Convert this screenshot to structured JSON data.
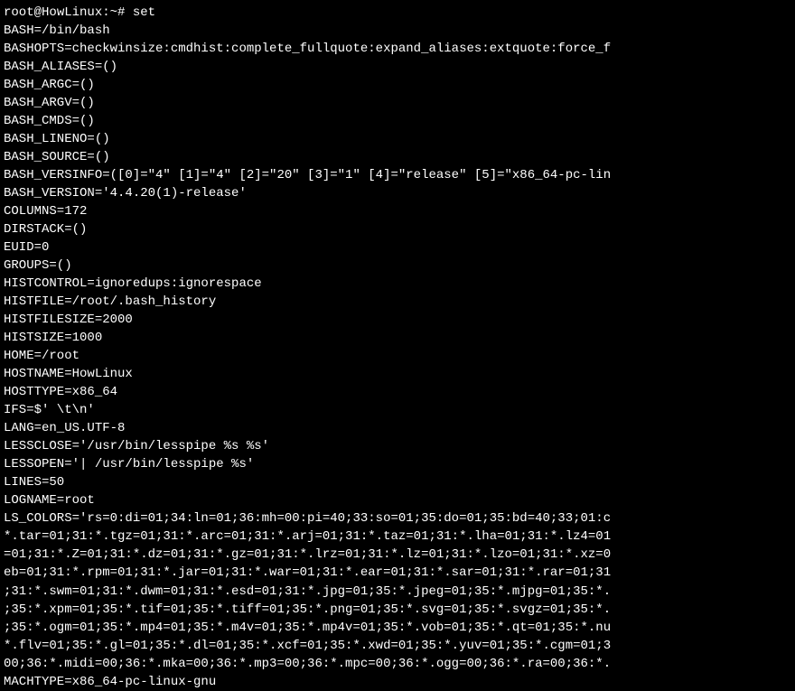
{
  "prompt": {
    "user": "root",
    "host": "HowLinux",
    "path": "~",
    "symbol": "#",
    "command": "set"
  },
  "output": [
    "BASH=/bin/bash",
    "BASHOPTS=checkwinsize:cmdhist:complete_fullquote:expand_aliases:extquote:force_f",
    "BASH_ALIASES=()",
    "BASH_ARGC=()",
    "BASH_ARGV=()",
    "BASH_CMDS=()",
    "BASH_LINENO=()",
    "BASH_SOURCE=()",
    "BASH_VERSINFO=([0]=\"4\" [1]=\"4\" [2]=\"20\" [3]=\"1\" [4]=\"release\" [5]=\"x86_64-pc-lin",
    "BASH_VERSION='4.4.20(1)-release'",
    "COLUMNS=172",
    "DIRSTACK=()",
    "EUID=0",
    "GROUPS=()",
    "HISTCONTROL=ignoredups:ignorespace",
    "HISTFILE=/root/.bash_history",
    "HISTFILESIZE=2000",
    "HISTSIZE=1000",
    "HOME=/root",
    "HOSTNAME=HowLinux",
    "HOSTTYPE=x86_64",
    "IFS=$' \\t\\n'",
    "LANG=en_US.UTF-8",
    "LESSCLOSE='/usr/bin/lesspipe %s %s'",
    "LESSOPEN='| /usr/bin/lesspipe %s'",
    "LINES=50",
    "LOGNAME=root",
    "LS_COLORS='rs=0:di=01;34:ln=01;36:mh=00:pi=40;33:so=01;35:do=01;35:bd=40;33;01:c",
    "*.tar=01;31:*.tgz=01;31:*.arc=01;31:*.arj=01;31:*.taz=01;31:*.lha=01;31:*.lz4=01",
    "=01;31:*.Z=01;31:*.dz=01;31:*.gz=01;31:*.lrz=01;31:*.lz=01;31:*.lzo=01;31:*.xz=0",
    "eb=01;31:*.rpm=01;31:*.jar=01;31:*.war=01;31:*.ear=01;31:*.sar=01;31:*.rar=01;31",
    ";31:*.swm=01;31:*.dwm=01;31:*.esd=01;31:*.jpg=01;35:*.jpeg=01;35:*.mjpg=01;35:*.",
    ";35:*.xpm=01;35:*.tif=01;35:*.tiff=01;35:*.png=01;35:*.svg=01;35:*.svgz=01;35:*.",
    ";35:*.ogm=01;35:*.mp4=01;35:*.m4v=01;35:*.mp4v=01;35:*.vob=01;35:*.qt=01;35:*.nu",
    "*.flv=01;35:*.gl=01;35:*.dl=01;35:*.xcf=01;35:*.xwd=01;35:*.yuv=01;35:*.cgm=01;3",
    "00;36:*.midi=00;36:*.mka=00;36:*.mp3=00;36:*.mpc=00;36:*.ogg=00;36:*.ra=00;36:*.",
    "MACHTYPE=x86_64-pc-linux-gnu"
  ]
}
